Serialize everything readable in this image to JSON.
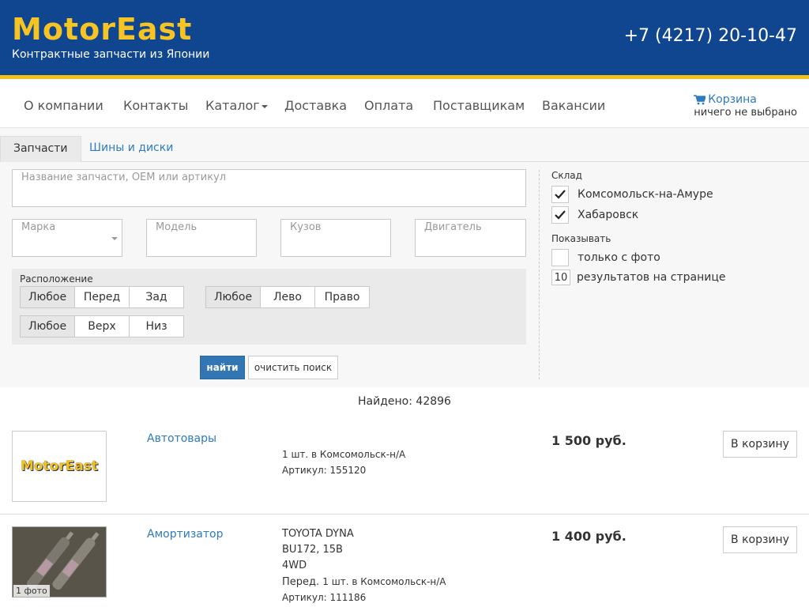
{
  "header": {
    "logo": "MotorEast",
    "tagline": "Контрактные запчасти из Японии",
    "phone": "+7 (4217) 20-10-47"
  },
  "nav": {
    "items": [
      "О компании",
      "Контакты",
      "Каталог",
      "Доставка",
      "Оплата",
      "Поставщикам",
      "Вакансии"
    ],
    "cart_label": "Корзина",
    "cart_status": "ничего не выбрано"
  },
  "tabs": [
    "Запчасти",
    "Шины и диски"
  ],
  "search": {
    "query_placeholder": "Название запчасти, OEM или артикул",
    "make_placeholder": "Марка",
    "model_placeholder": "Модель",
    "body_placeholder": "Кузов",
    "engine_placeholder": "Двигатель",
    "location_label": "Расположение",
    "group1": [
      "Любое",
      "Перед",
      "Зад"
    ],
    "group2": [
      "Любое",
      "Лево",
      "Право"
    ],
    "group3": [
      "Любое",
      "Верх",
      "Низ"
    ],
    "find_label": "найти",
    "clear_label": "очистить поиск"
  },
  "sidebar": {
    "warehouse_label": "Склад",
    "warehouses": [
      {
        "name": "Комсомольск-на-Амуре",
        "checked": true
      },
      {
        "name": "Хабаровск",
        "checked": true
      }
    ],
    "show_label": "Показывать",
    "photo_only": "только с фото",
    "per_page_value": "10",
    "per_page_label": "результатов на странице"
  },
  "results": {
    "found_text": "Найдено: 42896",
    "items": [
      {
        "name": "Автотовары",
        "lines": [],
        "stock": "1 шт. в Комсомольск-н/А",
        "article": "Артикул: 155120",
        "price": "1 500 руб.",
        "cart_label": "В корзину",
        "thumb_logo": "MotorEast"
      },
      {
        "name": "Амортизатор",
        "lines": [
          "TOYOTA DYNA",
          "BU172, 15B",
          "4WD"
        ],
        "position": "Перед.",
        "stock": "1 шт. в Комсомольск-н/А",
        "article": "Артикул: 111186",
        "price": "1 400 руб.",
        "cart_label": "В корзину",
        "photo_badge": "1 фото"
      }
    ]
  },
  "colors": {
    "header_bg": "#10458f",
    "accent": "#f2c21b",
    "link": "#2f7bbf",
    "button_primary": "#3277b3"
  }
}
